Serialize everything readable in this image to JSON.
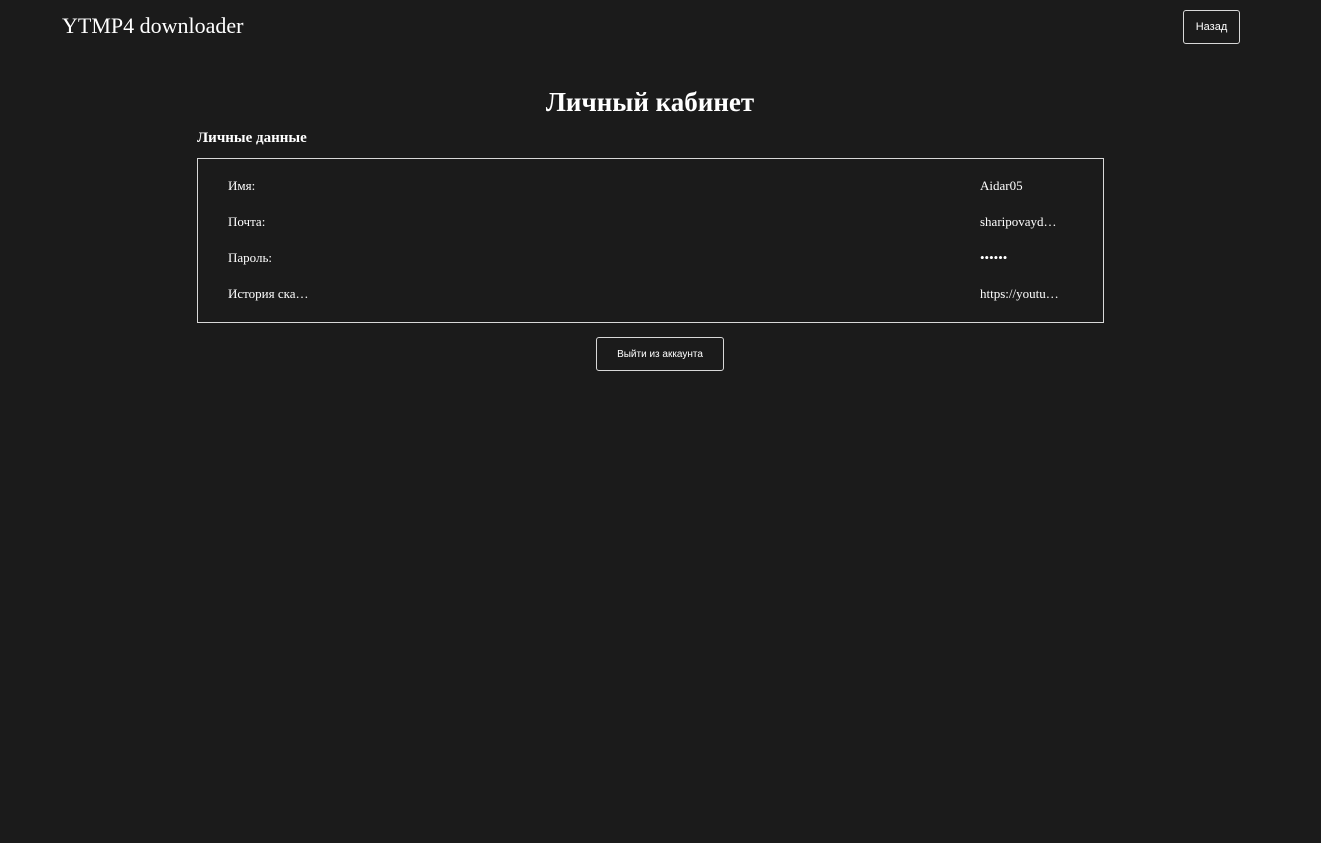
{
  "header": {
    "app_title": "YTMP4 downloader",
    "back_label": "Назад"
  },
  "main": {
    "title": "Личный кабинет",
    "section_title": "Личные данные",
    "fields": [
      {
        "label": "Имя:",
        "value": "Aidar05"
      },
      {
        "label": "Почта:",
        "value": "sharipovayd…"
      },
      {
        "label": "Пароль:",
        "value": "••••••"
      },
      {
        "label": "История ска…",
        "value": "https://youtu…"
      }
    ],
    "logout_label": "Выйти из аккаунта"
  },
  "colors": {
    "background": "#1b1b1b",
    "text": "#ffffff",
    "border": "#d8d8d8"
  }
}
